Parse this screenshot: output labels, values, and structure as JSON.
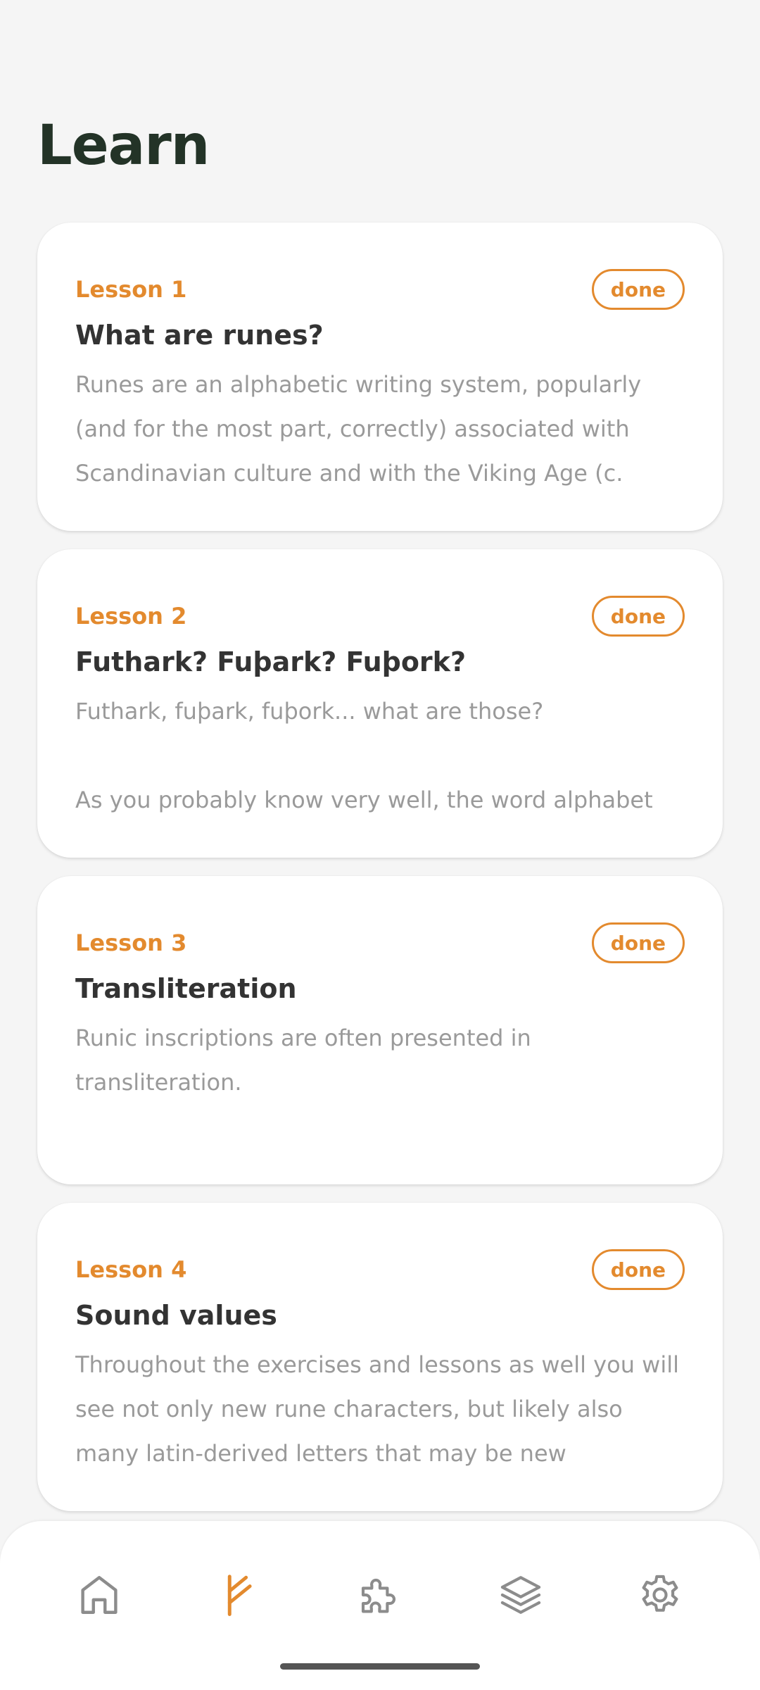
{
  "header": {
    "title": "Learn"
  },
  "lessons": [
    {
      "number": "Lesson 1",
      "status": "done",
      "title": "What are runes?",
      "excerpt": "Runes are an alphabetic writing system, popularly (and for the most part, correctly) associated with Scandinavian culture and with the Viking Age (c."
    },
    {
      "number": "Lesson 2",
      "status": "done",
      "title": "Futhark? Fuþark? Fuþork?",
      "excerpt": "Futhark, fuþark, fuþork... what are those?\n\nAs you probably know very well, the word alphabet"
    },
    {
      "number": "Lesson 3",
      "status": "done",
      "title": "Transliteration",
      "excerpt": "Runic inscriptions are often presented in transliteration."
    },
    {
      "number": "Lesson 4",
      "status": "done",
      "title": "Sound values",
      "excerpt": "Throughout the exercises and lessons as well you will see not only new rune characters, but likely also many latin-derived letters that may be new"
    }
  ],
  "bottom_nav": {
    "items": [
      {
        "icon": "home-icon",
        "active": false
      },
      {
        "icon": "rune-icon",
        "active": true
      },
      {
        "icon": "puzzle-icon",
        "active": false
      },
      {
        "icon": "layers-icon",
        "active": false
      },
      {
        "icon": "gear-icon",
        "active": false
      }
    ]
  },
  "colors": {
    "accent": "#e38a2e",
    "title": "#233327",
    "heading": "#333333",
    "muted": "#9a9a9a",
    "background": "#f5f5f5",
    "icon_inactive": "#8c8c8c"
  }
}
